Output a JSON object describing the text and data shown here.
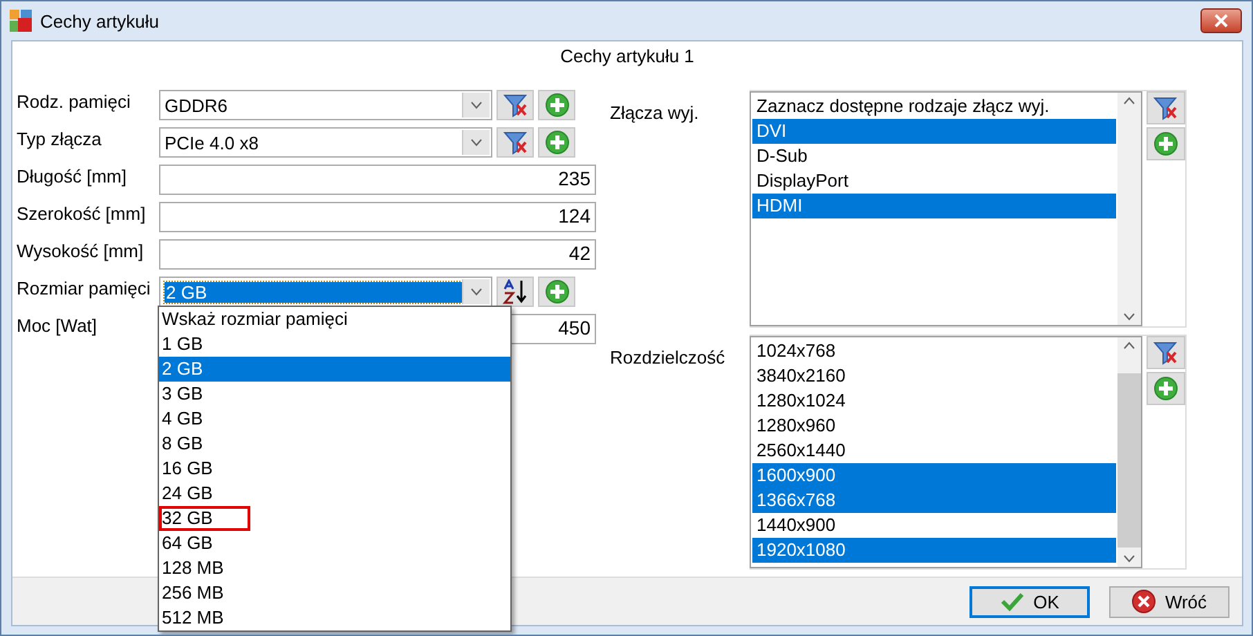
{
  "window": {
    "title": "Cechy artykułu"
  },
  "header": "Cechy artykułu 1",
  "fields": [
    {
      "label": "Rodz. pamięci",
      "kind": "combo",
      "value": "GDDR6",
      "focused": false,
      "tools": [
        {
          "kind": "filter-clear"
        },
        {
          "kind": "add"
        }
      ]
    },
    {
      "label": "Typ złącza",
      "kind": "combo",
      "value": "PCIe 4.0 x8",
      "focused": false,
      "tools": [
        {
          "kind": "filter-clear"
        },
        {
          "kind": "add"
        }
      ]
    },
    {
      "label": "Długość [mm]",
      "kind": "number",
      "value": "235"
    },
    {
      "label": "Szerokość [mm]",
      "kind": "number",
      "value": "124"
    },
    {
      "label": "Wysokość [mm]",
      "kind": "number",
      "value": "42"
    },
    {
      "label": "Rozmiar pamięci",
      "kind": "combo",
      "value": "2 GB",
      "focused": true,
      "tools": [
        {
          "kind": "sort"
        },
        {
          "kind": "add"
        }
      ]
    },
    {
      "label": "Moc [Wat]",
      "kind": "number",
      "value": "450"
    }
  ],
  "dropdown": {
    "items": [
      {
        "text": "Wskaż rozmiar pamięci",
        "selected": false,
        "outlined": false
      },
      {
        "text": "1 GB",
        "selected": false,
        "outlined": false
      },
      {
        "text": "2 GB",
        "selected": true,
        "outlined": false
      },
      {
        "text": "3 GB",
        "selected": false,
        "outlined": false
      },
      {
        "text": "4 GB",
        "selected": false,
        "outlined": false
      },
      {
        "text": "8 GB",
        "selected": false,
        "outlined": false
      },
      {
        "text": "16 GB",
        "selected": false,
        "outlined": false
      },
      {
        "text": "24 GB",
        "selected": false,
        "outlined": false
      },
      {
        "text": "32 GB",
        "selected": false,
        "outlined": true
      },
      {
        "text": "64 GB",
        "selected": false,
        "outlined": false
      },
      {
        "text": "128 MB",
        "selected": false,
        "outlined": false
      },
      {
        "text": "256 MB",
        "selected": false,
        "outlined": false
      },
      {
        "text": "512 MB",
        "selected": false,
        "outlined": false
      }
    ]
  },
  "lists": [
    {
      "label": "Złącza wyj.",
      "tools": [
        {
          "kind": "filter-clear"
        },
        {
          "kind": "add"
        }
      ],
      "items": [
        {
          "text": "Zaznacz dostępne rodzaje złącz wyj.",
          "selected": false
        },
        {
          "text": "DVI",
          "selected": true
        },
        {
          "text": "D-Sub",
          "selected": false
        },
        {
          "text": "DisplayPort",
          "selected": false
        },
        {
          "text": "HDMI",
          "selected": true
        }
      ]
    },
    {
      "label": "Rozdzielczość",
      "tools": [
        {
          "kind": "filter-clear"
        },
        {
          "kind": "add"
        }
      ],
      "items": [
        {
          "text": "1024x768",
          "selected": false
        },
        {
          "text": "3840x2160",
          "selected": false
        },
        {
          "text": "1280x1024",
          "selected": false
        },
        {
          "text": "1280x960",
          "selected": false
        },
        {
          "text": "2560x1440",
          "selected": false
        },
        {
          "text": "1600x900",
          "selected": true
        },
        {
          "text": "1366x768",
          "selected": true
        },
        {
          "text": "1440x900",
          "selected": false
        },
        {
          "text": "1920x1080",
          "selected": true
        }
      ]
    }
  ],
  "buttons": [
    {
      "label": "OK",
      "kind": "ok",
      "default": true
    },
    {
      "label": "Wróć",
      "kind": "cancel",
      "default": false
    }
  ]
}
